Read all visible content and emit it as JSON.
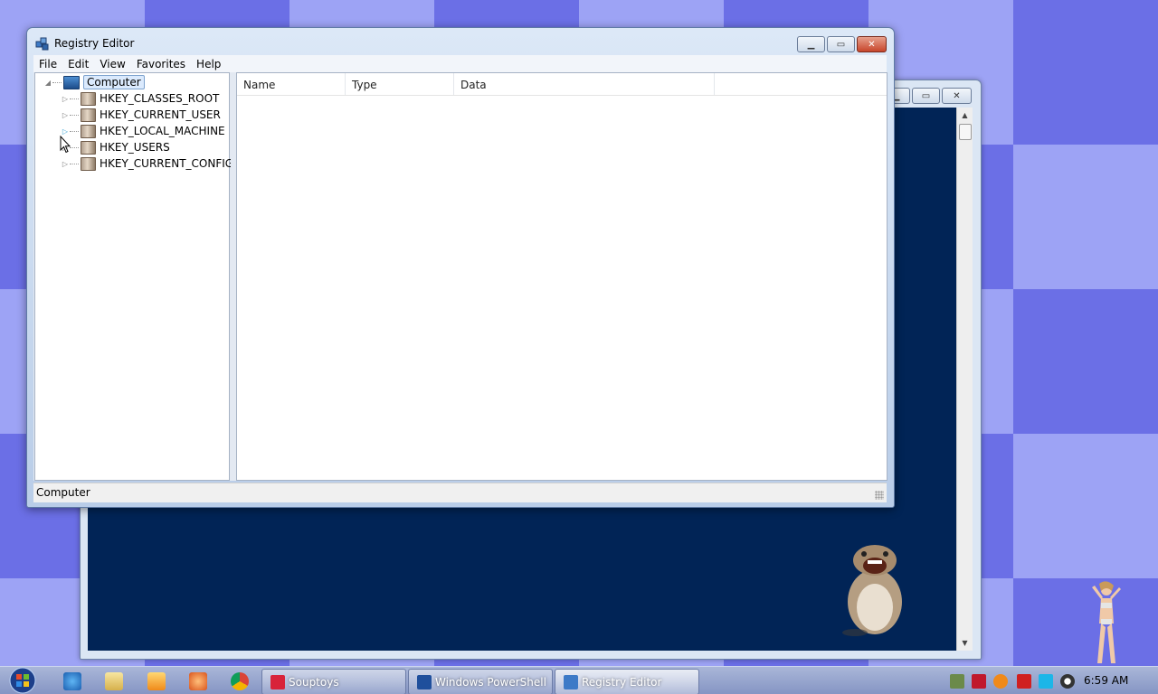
{
  "powershell_window": {
    "title": "Windows PowerShell"
  },
  "registry_window": {
    "title": "Registry Editor",
    "menu": [
      "File",
      "Edit",
      "View",
      "Favorites",
      "Help"
    ],
    "tree": {
      "root": "Computer",
      "keys": [
        "HKEY_CLASSES_ROOT",
        "HKEY_CURRENT_USER",
        "HKEY_LOCAL_MACHINE",
        "HKEY_USERS",
        "HKEY_CURRENT_CONFIG"
      ]
    },
    "columns": [
      "Name",
      "Type",
      "Data"
    ],
    "status": "Computer"
  },
  "taskbar": {
    "tasks": [
      {
        "label": "Souptoys",
        "icon": "souptoys-icon"
      },
      {
        "label": "Windows PowerShell",
        "icon": "powershell-icon"
      },
      {
        "label": "Registry Editor",
        "icon": "registry-icon"
      }
    ],
    "clock": "6:59 AM"
  },
  "colors": {
    "desktop_dark": "#6b6fe6",
    "desktop_light": "#9da3f5",
    "console_bg": "#012456"
  }
}
